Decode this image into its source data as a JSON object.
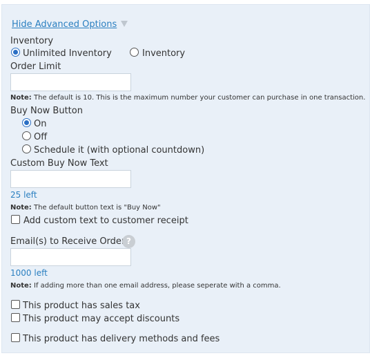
{
  "toggle": {
    "label": "Hide Advanced Options"
  },
  "inventory": {
    "label": "Inventory",
    "options": [
      "Unlimited Inventory",
      "Inventory"
    ],
    "selected": "Unlimited Inventory"
  },
  "order_limit": {
    "label": "Order Limit",
    "value": "",
    "note_prefix": "Note:",
    "note": "The default is 10. This is the maximum number your customer can purchase in one transaction."
  },
  "buy_now": {
    "label": "Buy Now Button",
    "options": [
      "On",
      "Off",
      "Schedule it (with optional countdown)"
    ],
    "selected": "On"
  },
  "custom_text": {
    "label": "Custom Buy Now Text",
    "value": "",
    "remaining": "25 left",
    "note_prefix": "Note:",
    "note": "The default button text is \"Buy Now\""
  },
  "receipt_checkbox": {
    "label": "Add custom text to customer receipt",
    "checked": false
  },
  "emails": {
    "label": "Email(s) to Receive Orders",
    "help_glyph": "?",
    "value": "",
    "remaining": "1000 left",
    "note_prefix": "Note:",
    "note": "If adding more than one email address, please seperate with a comma."
  },
  "checkboxes": {
    "sales_tax": "This product has sales tax",
    "discounts": "This product may accept discounts",
    "delivery": "This product has delivery methods and fees"
  },
  "colors": {
    "link": "#2a7fc0",
    "panel_bg": "#e9f0f8",
    "radio_accent": "#2b6fc4"
  }
}
